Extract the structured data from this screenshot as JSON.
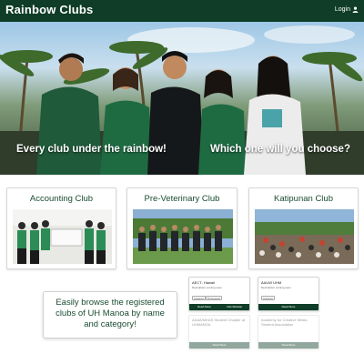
{
  "navbar": {
    "brand": "Rainbow Clubs",
    "login": "Login",
    "user_icon": "user-icon"
  },
  "hero": {
    "left_text": "Every club under the rainbow!",
    "right_text": "Which one will you choose?"
  },
  "clubs": [
    {
      "name": "Accounting Club"
    },
    {
      "name": "Pre-Veterinary Club"
    },
    {
      "name": "Katipunan Club"
    }
  ],
  "browse": {
    "text": "Easily browse the registered clubs of UH Manoa by name and category!"
  },
  "mini_cards": [
    {
      "title": "AECT- Hawaii",
      "desc": "Description coming soon",
      "tags": [
        "Academic",
        "Professional"
      ],
      "buttons": [
        "Read More",
        "Visit Website"
      ]
    },
    {
      "title": "AAUW UHM",
      "desc": "Description coming soon",
      "tags": [
        "Academic"
      ],
      "buttons": [
        "Read More"
      ]
    },
    {
      "title": "AAAA/MHAS Student Chapter at UHMANOA",
      "desc": "",
      "tags": [],
      "buttons": [
        "Read More"
      ]
    },
    {
      "title": "Academy for Creative Media Student Association",
      "desc": "",
      "tags": [],
      "buttons": [
        "Read More"
      ]
    }
  ],
  "colors": {
    "nav_green": "#0f3d27",
    "title_green": "#1b4d33"
  }
}
